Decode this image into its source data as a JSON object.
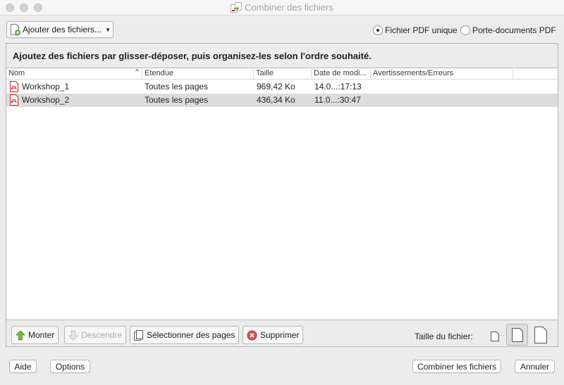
{
  "window": {
    "title": "Combiner des fichiers"
  },
  "toolbar": {
    "add_files_label": "Ajouter des fichiers...",
    "output_options": [
      {
        "label": "Fichier PDF unique",
        "checked": true
      },
      {
        "label": "Porte-documents PDF",
        "checked": false
      }
    ]
  },
  "instruction": "Ajoutez des fichiers par glisser-déposer, puis organisez-les selon l'ordre souhaité.",
  "table": {
    "columns": [
      "Nom",
      "Etendue",
      "Taille",
      "Date de modi...",
      "Avertissements/Erreurs"
    ],
    "sort_indicator": "^",
    "rows": [
      {
        "name": "Workshop_1",
        "range": "Toutes les pages",
        "size": "969,42 Ko",
        "date": "14.0...:17:13",
        "warnings": "",
        "selected": false
      },
      {
        "name": "Workshop_2",
        "range": "Toutes les pages",
        "size": "436,34 Ko",
        "date": "11.0...:30:47",
        "warnings": "",
        "selected": true
      }
    ]
  },
  "actions": {
    "move_up": "Monter",
    "move_down": "Descendre",
    "select_pages": "Sélectionner des pages",
    "delete": "Supprimer"
  },
  "file_size": {
    "label": "Taille du fichier:",
    "options": [
      "small-page-icon",
      "medium-page-icon",
      "large-page-icon"
    ],
    "selected": "medium-page-icon"
  },
  "footer": {
    "help": "Aide",
    "options": "Options",
    "combine": "Combiner les fichiers",
    "cancel": "Annuler"
  },
  "colors": {
    "selected_row": "#dcdcdc",
    "pdf_icon": "#d0221b",
    "move_up_arrow": "#6fbf3a"
  }
}
